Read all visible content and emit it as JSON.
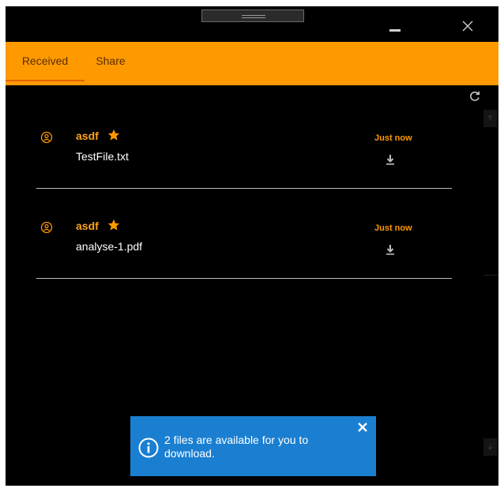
{
  "tabs": [
    {
      "label": "Received"
    },
    {
      "label": "Share"
    }
  ],
  "items": [
    {
      "sender": "asdf",
      "filename": "TestFile.txt",
      "time": "Just now"
    },
    {
      "sender": "asdf",
      "filename": "analyse-1.pdf",
      "time": "Just now"
    }
  ],
  "notification": {
    "message": "2 files are available for you to download."
  },
  "colors": {
    "accent": "#ff9900",
    "toast": "#1a7fd1",
    "background": "#000000"
  },
  "icons": [
    "minimize-icon",
    "close-icon",
    "refresh-icon",
    "avatar-icon",
    "star-icon",
    "download-icon",
    "info-icon"
  ]
}
